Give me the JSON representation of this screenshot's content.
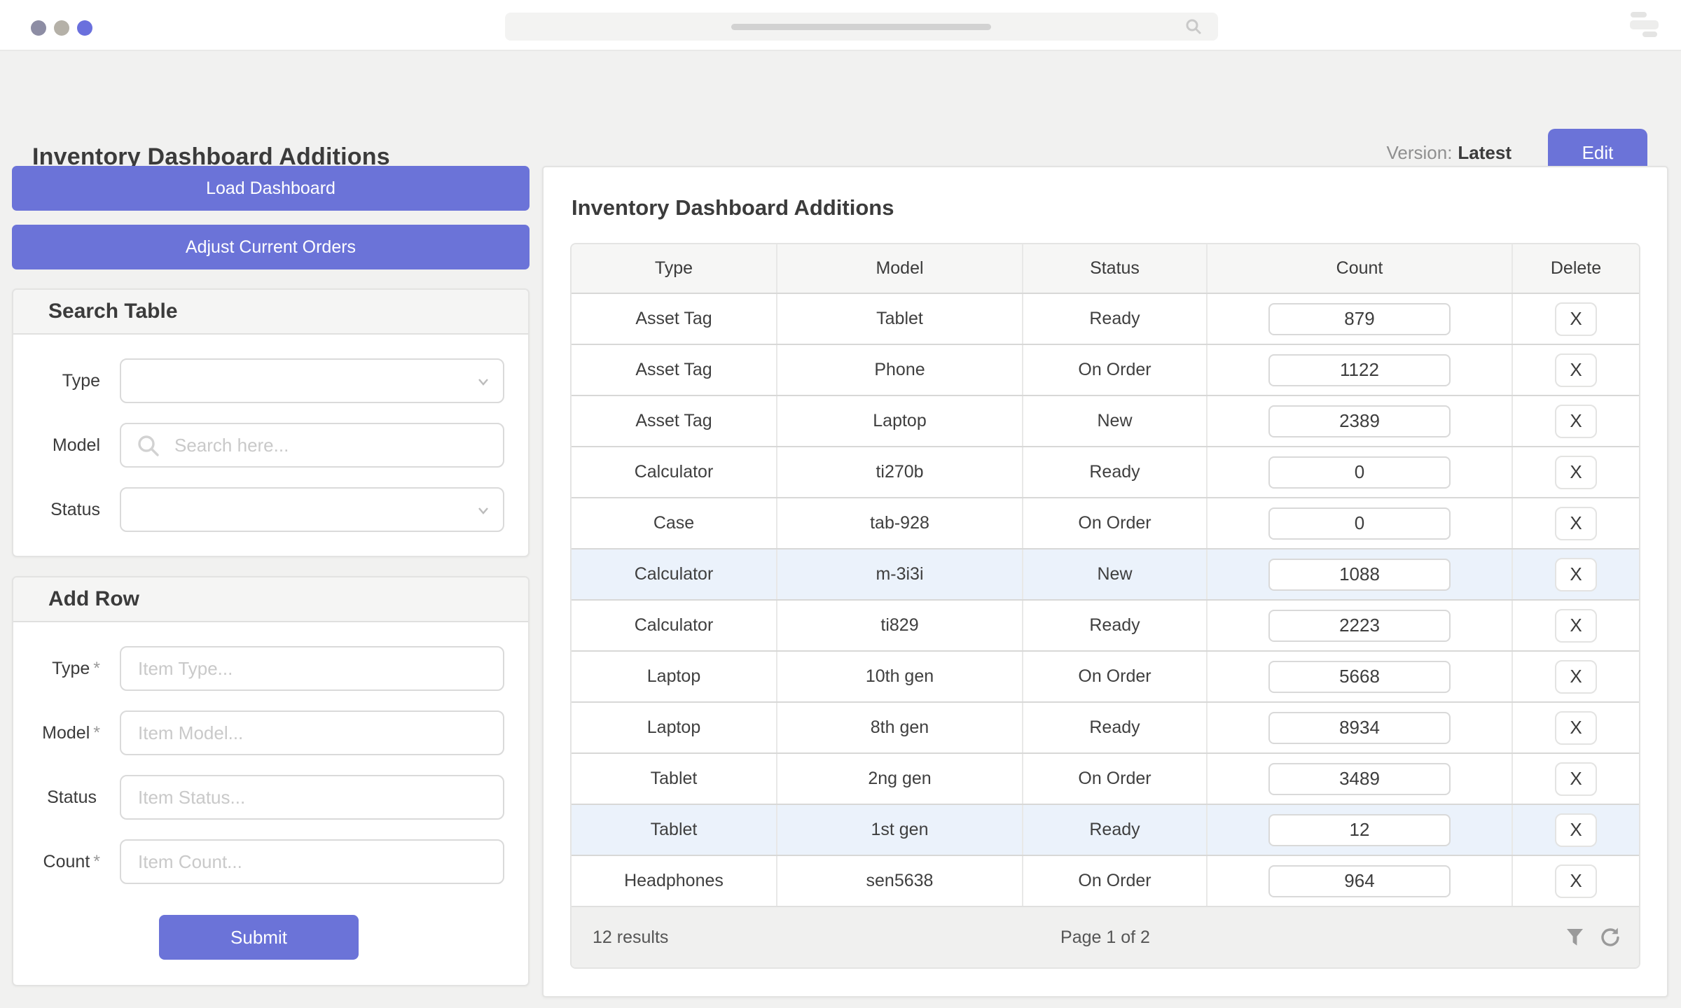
{
  "colors": {
    "accent": "#6b73d8",
    "row_highlight": "#ebf2fb",
    "page_background": "#f1f1f0",
    "dot_colors": [
      "#8d8da4",
      "#b5b1a8",
      "#6a70dd"
    ]
  },
  "header": {
    "title": "Inventory Dashboard Additions",
    "version_label": "Version:",
    "version_value": "Latest",
    "edit_button": "Edit"
  },
  "sidebar": {
    "load_button": "Load Dashboard",
    "adjust_button": "Adjust Current Orders",
    "search_section": {
      "title": "Search Table",
      "fields": [
        {
          "label": "Type",
          "control": "select",
          "value": ""
        },
        {
          "label": "Model",
          "control": "search",
          "placeholder": "Search here...",
          "value": ""
        },
        {
          "label": "Status",
          "control": "select",
          "value": ""
        }
      ]
    },
    "add_section": {
      "title": "Add Row",
      "fields": [
        {
          "label": "Type",
          "marker": "*",
          "placeholder": "Item Type...",
          "value": ""
        },
        {
          "label": "Model",
          "marker": "*",
          "placeholder": "Item Model...",
          "value": ""
        },
        {
          "label": "Status",
          "marker": "",
          "placeholder": "Item Status...",
          "value": ""
        },
        {
          "label": "Count",
          "marker": "*",
          "placeholder": "Item Count...",
          "value": ""
        }
      ],
      "submit_button": "Submit"
    }
  },
  "table": {
    "title": "Inventory Dashboard Additions",
    "columns": [
      "Type",
      "Model",
      "Status",
      "Count",
      "Delete"
    ],
    "delete_label": "X",
    "rows": [
      {
        "type": "Asset Tag",
        "model": "Tablet",
        "status": "Ready",
        "count": "879",
        "highlighted": false
      },
      {
        "type": "Asset Tag",
        "model": "Phone",
        "status": "On Order",
        "count": "1122",
        "highlighted": false
      },
      {
        "type": "Asset Tag",
        "model": "Laptop",
        "status": "New",
        "count": "2389",
        "highlighted": false
      },
      {
        "type": "Calculator",
        "model": "ti270b",
        "status": "Ready",
        "count": "0",
        "highlighted": false
      },
      {
        "type": "Case",
        "model": "tab-928",
        "status": "On Order",
        "count": "0",
        "highlighted": false
      },
      {
        "type": "Calculator",
        "model": "m-3i3i",
        "status": "New",
        "count": "1088",
        "highlighted": true
      },
      {
        "type": "Calculator",
        "model": "ti829",
        "status": "Ready",
        "count": "2223",
        "highlighted": false
      },
      {
        "type": "Laptop",
        "model": "10th gen",
        "status": "On Order",
        "count": "5668",
        "highlighted": false
      },
      {
        "type": "Laptop",
        "model": "8th gen",
        "status": "Ready",
        "count": "8934",
        "highlighted": false
      },
      {
        "type": "Tablet",
        "model": "2ng gen",
        "status": "On Order",
        "count": "3489",
        "highlighted": false
      },
      {
        "type": "Tablet",
        "model": "1st gen",
        "status": "Ready",
        "count": "12",
        "highlighted": true
      },
      {
        "type": "Headphones",
        "model": "sen5638",
        "status": "On Order",
        "count": "964",
        "highlighted": false
      }
    ],
    "footer": {
      "results": "12 results",
      "page": "Page 1 of 2"
    }
  }
}
